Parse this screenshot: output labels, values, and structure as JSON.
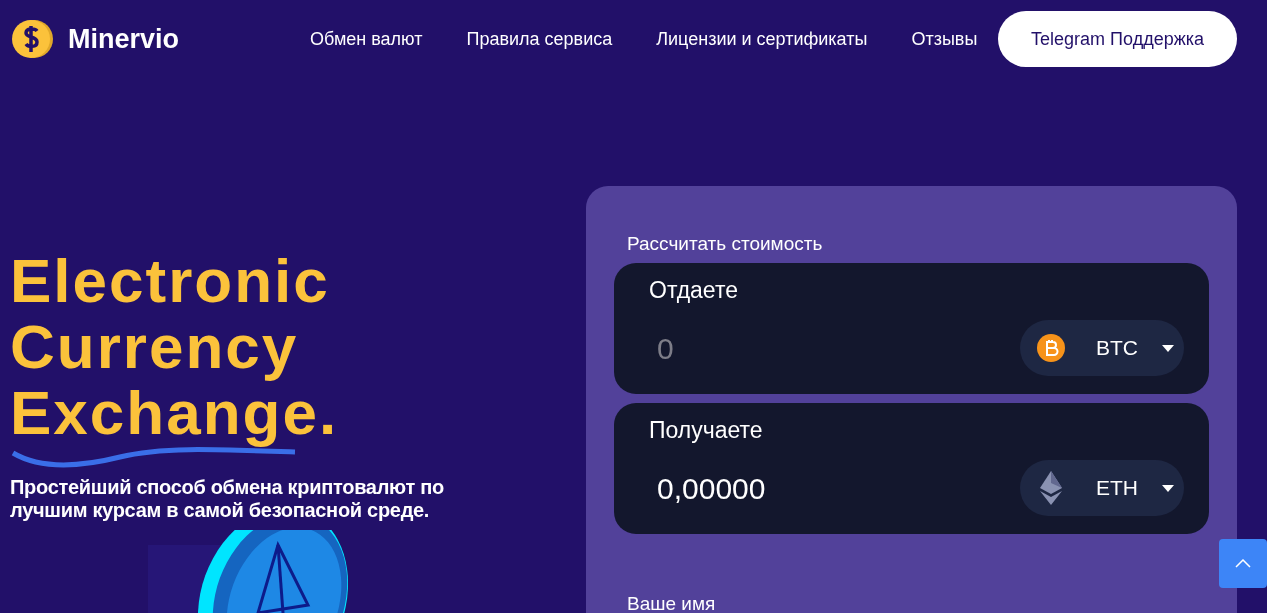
{
  "header": {
    "logo": "Minervio",
    "nav": [
      {
        "label": "Обмен валют"
      },
      {
        "label": "Правила сервиса"
      },
      {
        "label": "Лицензии и сертификаты"
      },
      {
        "label": "Отзывы"
      }
    ],
    "cta": "Telegram Поддержка"
  },
  "hero": {
    "title_lines": [
      "Electronic",
      "Currency",
      "Exchange."
    ],
    "subtitle": "Простейший способ обмена криптовалют по лучшим курсам в самой безопасной среде."
  },
  "calculator": {
    "title": "Рассчитать стоимость",
    "rows": [
      {
        "label": "Отдаете",
        "placeholder": "0",
        "currency": "BTC",
        "kind": "btc"
      },
      {
        "label": "Получаете",
        "value": "0,00000",
        "currency": "ETH",
        "kind": "eth"
      }
    ],
    "name_label": "Ваше имя"
  }
}
